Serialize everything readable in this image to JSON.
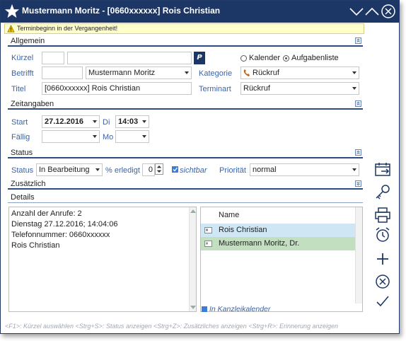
{
  "window": {
    "title": "Mustermann Moritz - [0660xxxxxx] Rois Christian"
  },
  "warning": {
    "text": "Terminbeginn in der Vergangenheit!"
  },
  "sections": {
    "allgemein": "Allgemein",
    "zeitangaben": "Zeitangaben",
    "status": "Status",
    "zusaetzlich": "Zusätzlich",
    "details": "Details"
  },
  "allgemein": {
    "kuerzel_label": "Kürzel",
    "kuerzel_value": "",
    "kuerzel_extra": "",
    "p_button": "P",
    "radio_kalender": "Kalender",
    "radio_aufgabenliste": "Aufgabenliste",
    "betrifft_label": "Betrifft",
    "betrifft_short": "",
    "betrifft_value": "Mustermann Moritz",
    "kategorie_label": "Kategorie",
    "kategorie_value": "Rückruf",
    "titel_label": "Titel",
    "titel_value": "[0660xxxxxx] Rois Christian",
    "terminart_label": "Terminart",
    "terminart_value": "Rückruf"
  },
  "zeitangaben": {
    "start_label": "Start",
    "start_date": "27.12.2016",
    "start_day": "Di",
    "start_time": "14:03",
    "faellig_label": "Fällig",
    "faellig_date": "",
    "faellig_day": "Mo",
    "faellig_time": ""
  },
  "status": {
    "status_label": "Status",
    "status_value": "In Bearbeitung",
    "erledigt_label": "% erledigt",
    "erledigt_value": "0",
    "sichtbar_label": "sichtbar",
    "prioritaet_label": "Priorität",
    "prioritaet_value": "normal"
  },
  "details": {
    "lines": [
      "Anzahl der Anrufe: 2",
      "Dienstag 27.12.2016; 14:04:06",
      "Telefonnummer: 0660xxxxxx",
      "Rois Christian"
    ]
  },
  "names": {
    "header": "Name",
    "rows": [
      {
        "name": "Rois Christian",
        "color": "#cfe6f5"
      },
      {
        "name": "Mustermann Moritz, Dr.",
        "color": "#c2dfbf"
      }
    ],
    "kanzlei_label": "In Kanzleikalender"
  },
  "statusbar": {
    "text": "<F1>: Kürzel auswählen <Strg+S>: Status anzeigen <Strg+Z>: Zusätzliches anzeigen <Strg+R>: Erinnerung anzeigen"
  },
  "colors": {
    "accent": "#1c3766",
    "label": "#3c64a8"
  },
  "icons": [
    "star-icon",
    "minimize-icon",
    "maximize-icon",
    "close-icon",
    "warning-icon",
    "phone-icon",
    "calendar-export-icon",
    "key-icon",
    "printer-icon",
    "alarm-clock-icon",
    "plus-icon",
    "cancel-icon",
    "checkmark-icon"
  ]
}
